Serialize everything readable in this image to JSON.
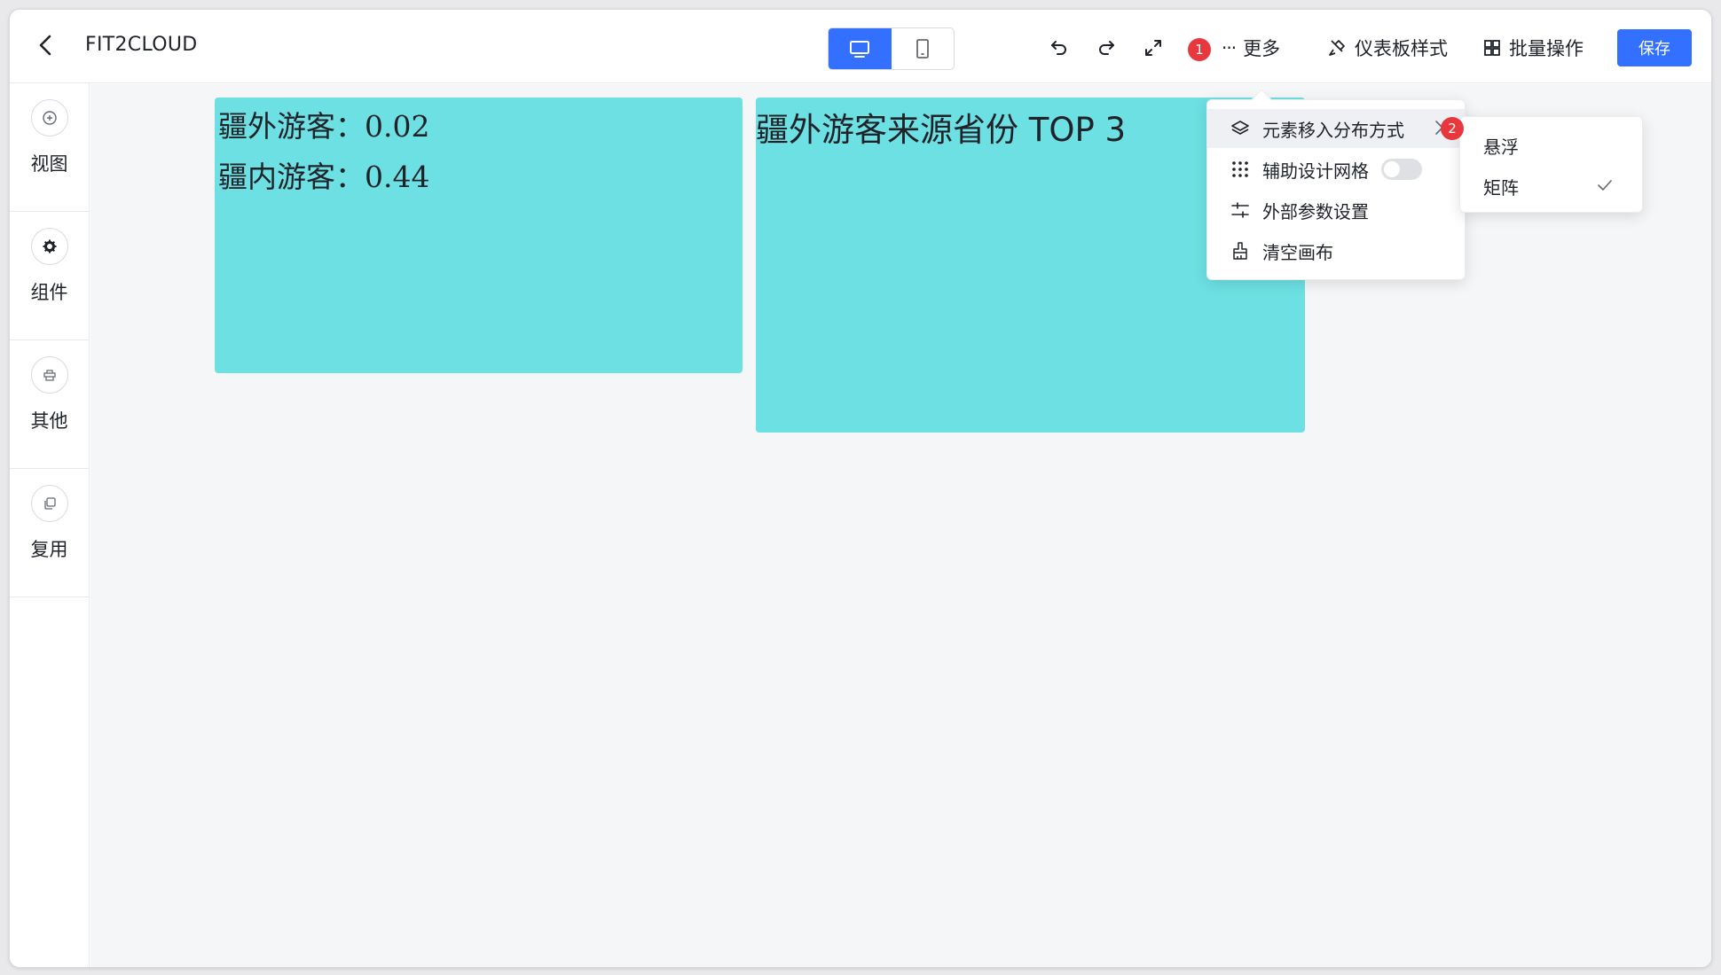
{
  "header": {
    "app_title": "FIT2CLOUD",
    "more_label": "更多",
    "more_dots": "···",
    "dashboard_style_label": "仪表板样式",
    "batch_ops_label": "批量操作",
    "save_label": "保存",
    "badge_1": "1",
    "device_active": "desktop"
  },
  "sidebar": {
    "items": [
      {
        "label": "视图",
        "icon": "plus-circle-icon"
      },
      {
        "label": "组件",
        "icon": "gear-icon"
      },
      {
        "label": "其他",
        "icon": "stamp-icon"
      },
      {
        "label": "复用",
        "icon": "copy-icon"
      }
    ]
  },
  "canvas": {
    "widget_color": "#6de0e3",
    "widget_1": {
      "line_1": "疆外游客：0.02",
      "line_2": "疆内游客：0.44"
    },
    "widget_2": {
      "title": "疆外游客来源省份 TOP 3"
    }
  },
  "menu": {
    "items": [
      {
        "label": "元素移入分布方式",
        "icon": "layers-icon",
        "has_submenu": true,
        "highlighted": true
      },
      {
        "label": "辅助设计网格",
        "icon": "grid-dots-icon",
        "toggle": false
      },
      {
        "label": "外部参数设置",
        "icon": "sliders-icon"
      },
      {
        "label": "清空画布",
        "icon": "brush-icon"
      }
    ],
    "badge_2": "2"
  },
  "submenu": {
    "items": [
      {
        "label": "悬浮",
        "checked": false
      },
      {
        "label": "矩阵",
        "checked": true
      }
    ]
  },
  "colors": {
    "primary": "#3370ff",
    "badge": "#e8383d",
    "canvas_bg": "#f5f6f7"
  }
}
